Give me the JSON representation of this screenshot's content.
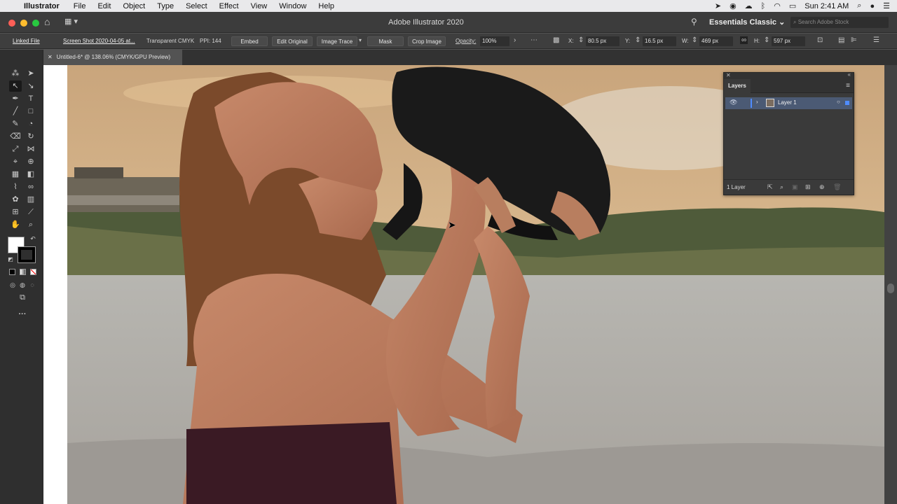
{
  "menubar": {
    "app_name": "Illustrator",
    "items": [
      "File",
      "Edit",
      "Object",
      "Type",
      "Select",
      "Effect",
      "View",
      "Window",
      "Help"
    ],
    "clock": "Sun 2:41 AM"
  },
  "window": {
    "title": "Adobe Illustrator 2020",
    "workspace": "Essentials Classic",
    "search_placeholder": "Search Adobe Stock"
  },
  "control_bar": {
    "linked_file": "Linked File",
    "file_name": "Screen Shot 2020-04-05 at...",
    "color_mode": "Transparent CMYK",
    "ppi": "PPI: 144",
    "embed": "Embed",
    "edit_original": "Edit Original",
    "image_trace": "Image Trace",
    "mask": "Mask",
    "crop_image": "Crop Image",
    "opacity_label": "Opacity:",
    "opacity_value": "100%",
    "x_label": "X:",
    "x_value": "80.5 px",
    "y_label": "Y:",
    "y_value": "16.5 px",
    "w_label": "W:",
    "w_value": "469 px",
    "h_label": "H:",
    "h_value": "597 px"
  },
  "document": {
    "tab_title": "Untitled-6* @ 138.06% (CMYK/GPU Preview)"
  },
  "layers_panel": {
    "title": "Layers",
    "layer_name": "Layer 1",
    "layer_count": "1 Layer",
    "highlight_color": "#4f8cff"
  },
  "colors": {
    "menubar_bg": "#e9e9eb",
    "chrome_bg": "#3e3e3e",
    "tools_bg": "#2f2f2f",
    "canvas_bg": "#535353"
  }
}
